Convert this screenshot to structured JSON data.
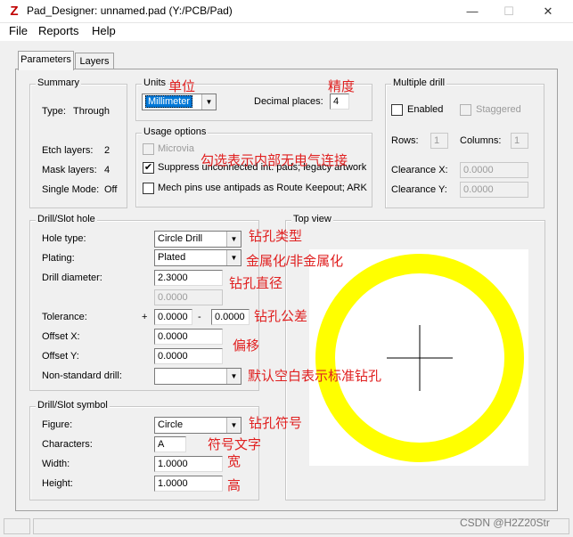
{
  "window": {
    "title": "Pad_Designer: unnamed.pad (Y:/PCB/Pad)",
    "app_icon": "pad-designer-icon",
    "minimize": "—",
    "maximize": "☐",
    "close": "✕"
  },
  "menu": [
    "File",
    "Reports",
    "Help"
  ],
  "tabs": [
    "Parameters",
    "Layers"
  ],
  "summary": {
    "title": "Summary",
    "type_label": "Type:",
    "type_value": "Through",
    "etch_label": "Etch layers:",
    "etch_value": "2",
    "mask_label": "Mask layers:",
    "mask_value": "4",
    "single_label": "Single Mode:",
    "single_value": "Off"
  },
  "units": {
    "title": "Units",
    "value": "Millimeter",
    "decimal_label": "Decimal places:",
    "decimal_value": "4"
  },
  "usage": {
    "title": "Usage options",
    "microvia": "Microvia",
    "suppress": "Suppress unconnected int. pads; legacy artwork",
    "suppress_checked": "✔",
    "mech": "Mech pins use antipads as Route Keepout; ARK"
  },
  "multidrill": {
    "title": "Multiple drill",
    "enabled": "Enabled",
    "staggered": "Staggered",
    "rows_label": "Rows:",
    "rows_value": "1",
    "columns_label": "Columns:",
    "columns_value": "1",
    "clearance_x_label": "Clearance X:",
    "clearance_x_value": "0.0000",
    "clearance_y_label": "Clearance Y:",
    "clearance_y_value": "0.0000"
  },
  "drill": {
    "title": "Drill/Slot hole",
    "hole_type_label": "Hole type:",
    "hole_type_value": "Circle Drill",
    "plating_label": "Plating:",
    "plating_value": "Plated",
    "diameter_label": "Drill diameter:",
    "diameter_value": "2.3000",
    "diameter2_value": "0.0000",
    "tolerance_label": "Tolerance:",
    "plus": "+",
    "minus": "-",
    "tol_plus_value": "0.0000",
    "tol_minus_value": "0.0000",
    "offset_x_label": "Offset X:",
    "offset_x_value": "0.0000",
    "offset_y_label": "Offset Y:",
    "offset_y_value": "0.0000",
    "nonstd_label": "Non-standard drill:",
    "nonstd_value": ""
  },
  "symbol": {
    "title": "Drill/Slot symbol",
    "figure_label": "Figure:",
    "figure_value": "Circle",
    "chars_label": "Characters:",
    "chars_value": "A",
    "width_label": "Width:",
    "width_value": "1.0000",
    "height_label": "Height:",
    "height_value": "1.0000"
  },
  "topview": {
    "title": "Top view",
    "ring_color": "#ffff00"
  },
  "annotations": {
    "units": "单位",
    "precision": "精度",
    "usage": "勾选表示内部无电气连接",
    "hole_type": "钻孔类型",
    "plating": "金属化/非金属化",
    "diameter": "钻孔直径",
    "tolerance": "钻孔公差",
    "offset": "偏移",
    "nonstd": "默认空白表示标准钻孔",
    "symbol": "钻孔符号",
    "chars": "符号文字",
    "width": "宽",
    "height": "高"
  },
  "watermark": "CSDN @H2Z20Str",
  "dropdown_arrow": "▼"
}
